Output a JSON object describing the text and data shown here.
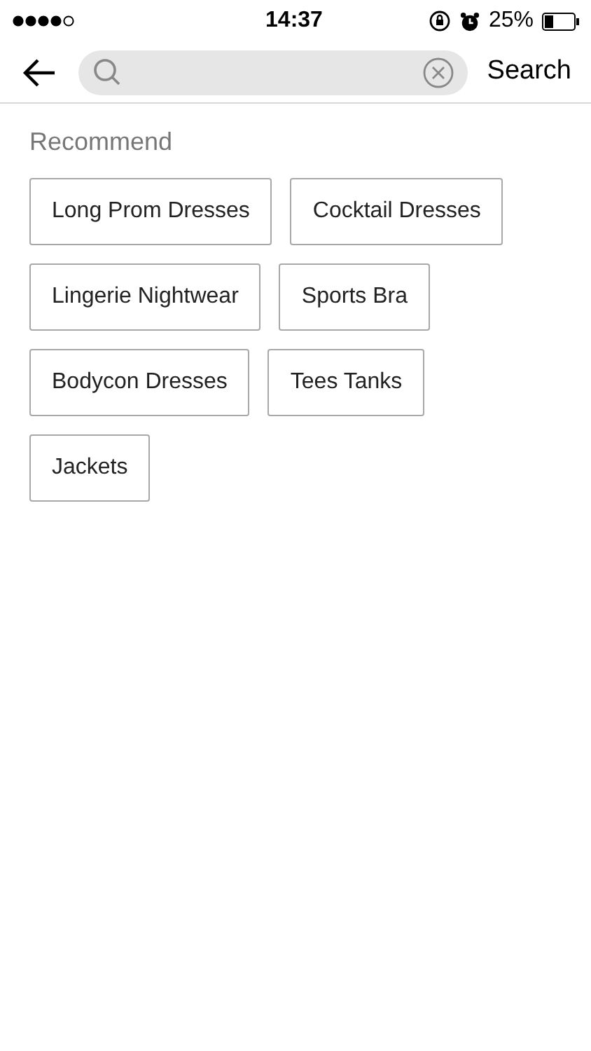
{
  "status_bar": {
    "time": "14:37",
    "battery": "25%"
  },
  "search": {
    "action": "Search"
  },
  "recommend": {
    "title": "Recommend",
    "tags": [
      "Long Prom Dresses",
      "Cocktail Dresses",
      "Lingerie Nightwear",
      "Sports Bra",
      "Bodycon Dresses",
      "Tees Tanks",
      "Jackets"
    ]
  }
}
